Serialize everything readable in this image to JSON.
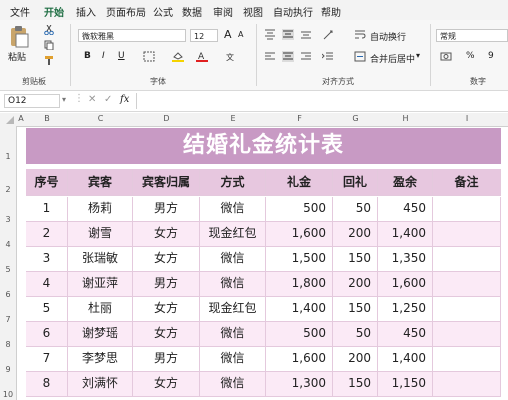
{
  "menu": [
    "文件",
    "开始",
    "插入",
    "页面布局",
    "公式",
    "数据",
    "审阅",
    "视图",
    "自动执行",
    "帮助"
  ],
  "ribbon": {
    "paste_label": "粘贴",
    "clipboard_label": "剪贴板",
    "font_name": "微软雅黑",
    "font_size": "12",
    "font_label": "字体",
    "wrap_label": "自动换行",
    "merge_label": "合并后居中",
    "align_label": "对齐方式",
    "number_format": "常规",
    "number_label": "数字",
    "bold": "B",
    "italic": "I",
    "underline": "U",
    "grow_font": "A",
    "shrink_font": "A",
    "percent": "%",
    "comma": "9"
  },
  "formula_bar": {
    "name_box": "O12",
    "fx": "fx",
    "formula": ""
  },
  "columns": [
    "A",
    "B",
    "C",
    "D",
    "E",
    "F",
    "G",
    "H",
    "I"
  ],
  "row_numbers": [
    "1",
    "2",
    "3",
    "4",
    "5",
    "6",
    "7",
    "8",
    "9",
    "10"
  ],
  "sheet": {
    "title": "结婚礼金统计表",
    "headers": [
      "序号",
      "宾客",
      "宾客归属",
      "方式",
      "礼金",
      "回礼",
      "盈余",
      "备注"
    ],
    "rows": [
      [
        "1",
        "杨莉",
        "男方",
        "微信",
        "500",
        "50",
        "450",
        ""
      ],
      [
        "2",
        "谢雪",
        "女方",
        "现金红包",
        "1,600",
        "200",
        "1,400",
        ""
      ],
      [
        "3",
        "张瑞敏",
        "女方",
        "微信",
        "1,500",
        "150",
        "1,350",
        ""
      ],
      [
        "4",
        "谢亚萍",
        "男方",
        "微信",
        "1,800",
        "200",
        "1,600",
        ""
      ],
      [
        "5",
        "杜丽",
        "女方",
        "现金红包",
        "1,400",
        "150",
        "1,250",
        ""
      ],
      [
        "6",
        "谢梦瑶",
        "女方",
        "微信",
        "500",
        "50",
        "450",
        ""
      ],
      [
        "7",
        "李梦思",
        "男方",
        "微信",
        "1,600",
        "200",
        "1,400",
        ""
      ],
      [
        "8",
        "刘满怀",
        "女方",
        "微信",
        "1,300",
        "150",
        "1,150",
        ""
      ]
    ]
  },
  "colors": {
    "title_bg": "#c89ac4",
    "header_bg": "#e7c7df",
    "band_bg": "#fbeaf6",
    "accent": "#1f6e43"
  }
}
